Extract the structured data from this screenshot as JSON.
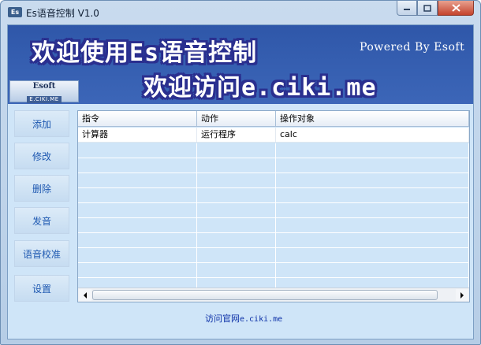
{
  "window": {
    "title": "Es语音控制 V1.0",
    "icon_text": "Es"
  },
  "banner": {
    "line1": "欢迎使用Es语音控制",
    "line2": "欢迎访问e.ciki.me",
    "powered": "Powered By Esoft"
  },
  "logo": {
    "main": "Esoft",
    "sub": "E.CIKI.ME"
  },
  "sidebar": {
    "add": "添加",
    "edit": "修改",
    "delete": "删除",
    "speak": "发音",
    "calibrate": "语音校准",
    "settings": "设置"
  },
  "table": {
    "columns": [
      "指令",
      "动作",
      "操作对象"
    ],
    "rows": [
      [
        "计算器",
        "运行程序",
        "calc"
      ]
    ]
  },
  "footer": {
    "link_prefix": "访问官网",
    "link_suffix": "e.ciki.me"
  },
  "colors": {
    "banner_bg": "#2f57a9",
    "client_bg": "#cfe5f8",
    "button_text": "#1f59b1",
    "link": "#0a2ea6"
  },
  "icons": [
    "minimize-icon",
    "maximize-icon",
    "close-icon",
    "scroll-left-icon",
    "scroll-right-icon"
  ]
}
